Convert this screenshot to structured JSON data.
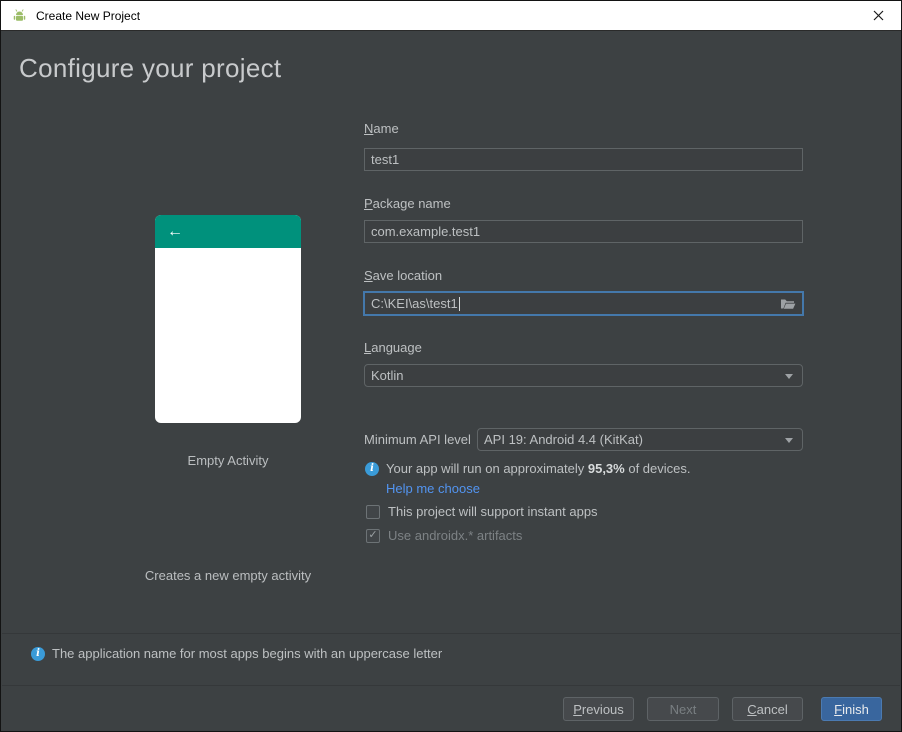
{
  "window": {
    "title": "Create New Project"
  },
  "header": {
    "title": "Configure your project"
  },
  "template_preview": {
    "name": "Empty Activity",
    "description": "Creates a new empty activity",
    "back_arrow": "←"
  },
  "form": {
    "name": {
      "label": "Name",
      "value": "test1"
    },
    "package_name": {
      "label": "Package name",
      "value": "com.example.test1"
    },
    "save_location": {
      "label": "Save location",
      "value": "C:\\KEI\\as\\test1"
    },
    "language": {
      "label": "Language",
      "value": "Kotlin"
    },
    "min_api": {
      "label": "Minimum API level",
      "value": "API 19: Android 4.4 (KitKat)"
    },
    "api_info": {
      "prefix": "Your app will run on approximately ",
      "highlight": "95,3%",
      "suffix": " of devices."
    },
    "help_link": "Help me choose",
    "checkboxes": [
      {
        "label": "This project will support instant apps",
        "checked": false
      },
      {
        "label": "Use androidx.* artifacts",
        "checked": true,
        "disabled": true
      }
    ]
  },
  "footer": {
    "hint": "The application name for most apps begins with an uppercase letter"
  },
  "buttons": {
    "previous": "Previous",
    "next": "Next",
    "cancel": "Cancel",
    "finish": "Finish"
  },
  "colors": {
    "accent_teal": "#00917c",
    "link_blue": "#5294f0",
    "info_blue": "#3a9bd8",
    "finish_button_blue": "#39669e",
    "titlebar_bg": "#ffffff",
    "dialog_bg": "#3d4143"
  }
}
